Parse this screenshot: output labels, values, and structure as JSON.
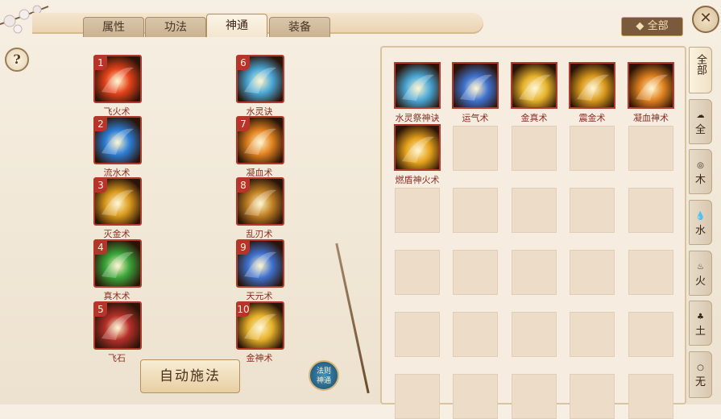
{
  "tabs": [
    {
      "label": "属性"
    },
    {
      "label": "功法"
    },
    {
      "label": "神通"
    },
    {
      "label": "装备"
    }
  ],
  "active_tab": "神通",
  "all_button": "全部",
  "close_icon": "close-icon",
  "help_icon": "help-icon",
  "slots": [
    {
      "num": "1",
      "name": "飞火术",
      "color": "#e5431b"
    },
    {
      "num": "2",
      "name": "流水术",
      "color": "#2c7ed6"
    },
    {
      "num": "3",
      "name": "灭金术",
      "color": "#d99a1d"
    },
    {
      "num": "4",
      "name": "真木术",
      "color": "#3aa53a"
    },
    {
      "num": "5",
      "name": "飞石",
      "color": "#b5302a"
    },
    {
      "num": "6",
      "name": "水灵诀",
      "color": "#4aa8d8"
    },
    {
      "num": "7",
      "name": "凝血术",
      "color": "#e0821f"
    },
    {
      "num": "8",
      "name": "乱刃术",
      "color": "#c28225"
    },
    {
      "num": "9",
      "name": "天元术",
      "color": "#3f72cf"
    },
    {
      "num": "10",
      "name": "金神术",
      "color": "#e6b22a"
    }
  ],
  "auto_button": "自动施法",
  "magic_button": {
    "line1": "法则",
    "line2": "神通"
  },
  "panel_skills": [
    {
      "name": "水灵祭神诀",
      "color": "#4aa8d8"
    },
    {
      "name": "运气术",
      "color": "#3f72cf"
    },
    {
      "name": "金真术",
      "color": "#e6b22a"
    },
    {
      "name": "震金术",
      "color": "#d99a1d"
    },
    {
      "name": "凝血神术",
      "color": "#e0821f"
    },
    {
      "name": "燃盾神火术",
      "color": "#e5a21b"
    }
  ],
  "side_tabs": [
    {
      "label": "全部",
      "glyph": ""
    },
    {
      "label": "全",
      "glyph": "☁"
    },
    {
      "label": "木",
      "glyph": "◎"
    },
    {
      "label": "水",
      "glyph": "💧"
    },
    {
      "label": "火",
      "glyph": "♨"
    },
    {
      "label": "土",
      "glyph": "♣"
    },
    {
      "label": "无",
      "glyph": "○"
    }
  ]
}
